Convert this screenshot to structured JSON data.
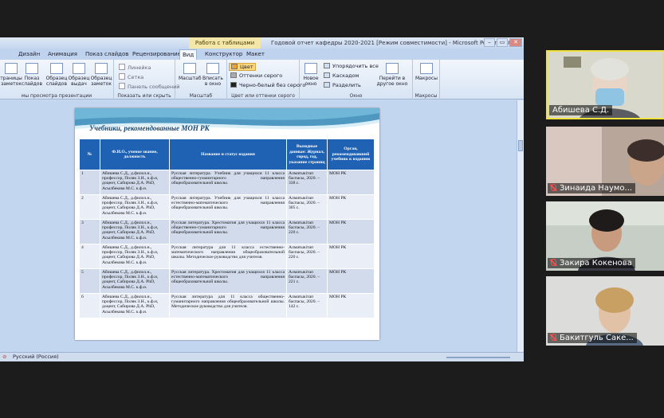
{
  "app": {
    "context_tab": "Работа с таблицами",
    "doc_title": "Годовой отчет кафедры 2020-2021 [Режим совместимости] - Microsoft PowerPoint",
    "window_buttons": [
      "–",
      "▭",
      "✕"
    ]
  },
  "ribbon_tabs": [
    {
      "label": "Дизайн"
    },
    {
      "label": "Анимация"
    },
    {
      "label": "Показ слайдов"
    },
    {
      "label": "Рецензирование"
    },
    {
      "label": "Вид",
      "active": true
    },
    {
      "label": "Конструктор"
    },
    {
      "label": "Макет"
    }
  ],
  "ribbon": {
    "views": {
      "buttons": [
        "траницы заметок",
        "Показ слайдов",
        "Образец слайдов",
        "Образец выдач",
        "Образец заметок"
      ],
      "group_label": "мы просмотра презентации"
    },
    "show_hide": {
      "checks": [
        "Линейка",
        "Сетка",
        "Панель сообщений"
      ],
      "group_label": "Показать или скрыть"
    },
    "zoom": {
      "buttons": [
        "Масштаб",
        "Вписать в окно"
      ],
      "group_label": "Масштаб"
    },
    "color": {
      "options": [
        "Цвет",
        "Оттенки серого",
        "Черно-белый без серого"
      ],
      "group_label": "Цвет или оттенки серого"
    },
    "window": {
      "new_window": "Новое окно",
      "options": [
        "Упорядочить все",
        "Каскадом",
        "Разделить"
      ],
      "switch": "Перейти в другое окно",
      "group_label": "Окно"
    },
    "macros": {
      "button": "Макросы",
      "group_label": "Макросы"
    }
  },
  "slide": {
    "title": "Учебники, рекомендованные МОН РК",
    "headers": [
      "№",
      "Ф.И.О., ученое звание, должность",
      "Название и статус издания",
      "Выходные данные: Журнал, город, год, указание страниц",
      "Орган, рекомендовавший учебник к изданию"
    ],
    "rows": [
      {
        "num": "1",
        "authors": "Абишева С.Д., д.филол.н., профессор, Поляк З.Н., к.ф.н, доцент, Сабирова Д.А. PhD, Асылбекова М.С. к.ф.н.",
        "title": "Русская литература. Учебник для учащихся 11 класса общественно-гуманитарного направления общеобразовательной школы.",
        "pub": "Алматыкітап баспасы, 2020. – 338 с.",
        "org": "МОН РК"
      },
      {
        "num": "2",
        "authors": "Абишева С.Д., д.филол.н., профессор, Поляк З.Н., к.ф.н, доцент, Сабирова Д.А. PhD, Асылбекова М.С. к.ф.н.",
        "title": "Русская литература. Учебник для учащихся 11 класса естественно-математического направления общеобразовательной школы.",
        "pub": "Алматыкітап баспасы, 2020. – 305 с.",
        "org": "МОН РК"
      },
      {
        "num": "3",
        "authors": "Абишева С.Д., д.филол.н., профессор, Поляк З.Н., к.ф.н, доцент, Сабирова Д.А. PhD, Асылбекова М.С. к.ф.н.",
        "title": "Русская литература. Хрестоматия для учащихся 11 класса общественно-гуманитарного направления общеобразовательной школы.",
        "pub": "Алматыкітап баспасы, 2020. – 220 с.",
        "org": "МОН РК"
      },
      {
        "num": "4",
        "authors": "Абишева С.Д., д.филол.н., профессор, Поляк З.Н., к.ф.н, доцент, Сабирова Д.А. PhD, Асылбекова М.С. к.ф.н.",
        "title": "Русская литература для 11 класса естественно-математического направления общеобразовательной школы. Методическое руководство для учителя.",
        "pub": "Алматыкітап баспасы, 2020. – 220 с.",
        "org": "МОН РК"
      },
      {
        "num": "5",
        "authors": "Абишева С.Д., д.филол.н., профессор, Поляк З.Н., к.ф.н, доцент, Сабирова Д.А. PhD, Асылбекова М.С. к.ф.н.",
        "title": "Русская литература. Хрестоматия для учащихся 11 класса естественно-математического направления общеобразовательной школы.",
        "pub": "Алматыкітап баспасы, 2020. – 221 с.",
        "org": "МОН РК"
      },
      {
        "num": "6",
        "authors": "Абишева С.Д., д.филол.н., профессор, Поляк З.Н., к.ф.н, доцент, Сабирова Д.А. PhD, Асылбекова М.С. к.ф.н.",
        "title": "Русская литература для 11 класса общественно-гуманитарного направления общеобразовательной школы. Методическое руководство для учителя.",
        "pub": "Алматыкітап баспасы, 2020. – 142 с.",
        "org": "МОН РК"
      }
    ]
  },
  "status": {
    "language": "Русский (Россия)"
  },
  "participants": [
    {
      "name": "Абишева С.Д.",
      "muted": false,
      "active": true
    },
    {
      "name": "Зинаида Наумо...",
      "muted": true,
      "active": false
    },
    {
      "name": "Закира Кокенова",
      "muted": true,
      "active": false
    },
    {
      "name": "Бакитгуль Саке...",
      "muted": true,
      "active": false
    }
  ],
  "colors": {
    "table_header": "#1f62b4",
    "row_odd": "#d2dbeb",
    "row_even": "#eaeff7",
    "title_text": "#15446c",
    "active_speaker_border": "#f0e23a",
    "mute_icon": "#ff4d4d"
  }
}
